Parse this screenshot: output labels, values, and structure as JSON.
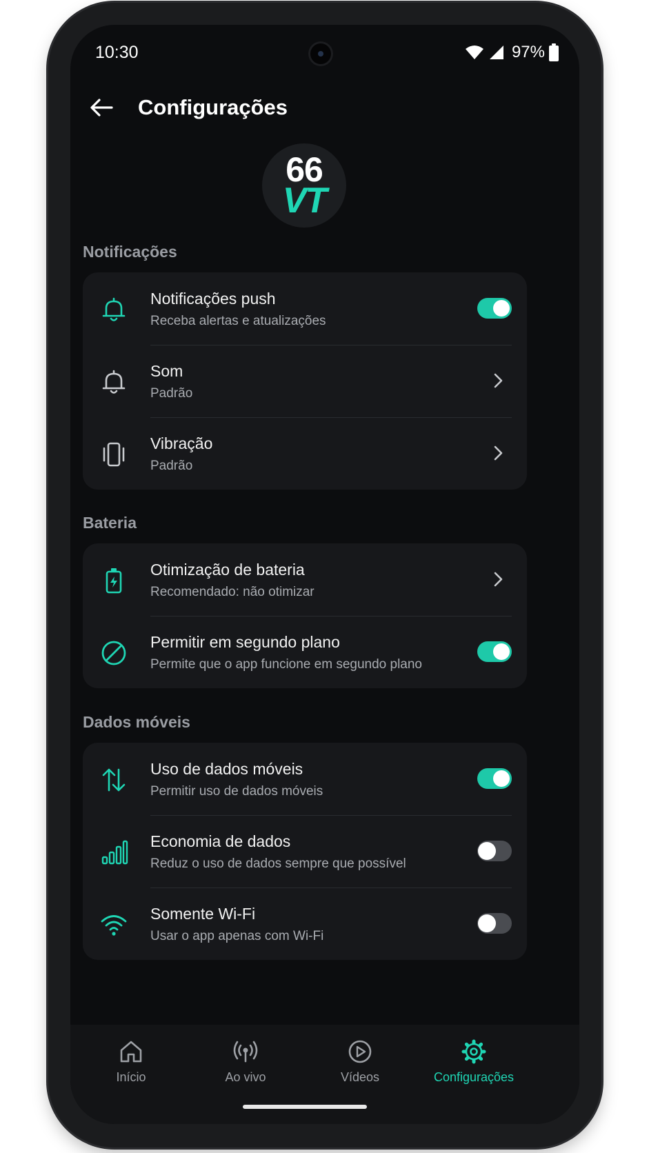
{
  "status_bar": {
    "time": "10:30",
    "battery": "97%"
  },
  "header": {
    "title": "Configurações"
  },
  "logo": {
    "line1": "66",
    "line2": "VT"
  },
  "sections": {
    "notifications": {
      "label": "Notificações",
      "items": [
        {
          "title": "Notificações push",
          "subtitle": "Receba alertas e atualizações",
          "control": "toggle",
          "enabled": true
        },
        {
          "title": "Som",
          "subtitle": "Padrão",
          "control": "chevron"
        },
        {
          "title": "Vibração",
          "subtitle": "Padrão",
          "control": "chevron"
        }
      ]
    },
    "battery": {
      "label": "Bateria",
      "items": [
        {
          "title": "Otimização de bateria",
          "subtitle": "Recomendado: não otimizar",
          "control": "chevron"
        },
        {
          "title": "Permitir em segundo plano",
          "subtitle": "Permite que o app funcione em segundo plano",
          "control": "toggle",
          "enabled": true
        }
      ]
    },
    "mobile_data": {
      "label": "Dados móveis",
      "items": [
        {
          "title": "Uso de dados móveis",
          "subtitle": "Permitir uso de dados móveis",
          "control": "toggle",
          "enabled": true
        },
        {
          "title": "Economia de dados",
          "subtitle": "Reduz o uso de dados sempre que possível",
          "control": "toggle",
          "enabled": false
        },
        {
          "title": "Somente Wi-Fi",
          "subtitle": "Usar o app apenas com Wi-Fi",
          "control": "toggle",
          "enabled": false
        }
      ]
    }
  },
  "bottom_nav": {
    "items": [
      {
        "label": "Início",
        "icon": "home-icon",
        "active": false
      },
      {
        "label": "Ao vivo",
        "icon": "broadcast-icon",
        "active": false
      },
      {
        "label": "Vídeos",
        "icon": "play-circle-icon",
        "active": false
      },
      {
        "label": "Configurações",
        "icon": "gear-icon",
        "active": true
      }
    ]
  },
  "colors": {
    "accent": "#1fd6b4",
    "background": "#0c0d0f",
    "card": "#17181b",
    "muted_text": "#a9acb1"
  }
}
